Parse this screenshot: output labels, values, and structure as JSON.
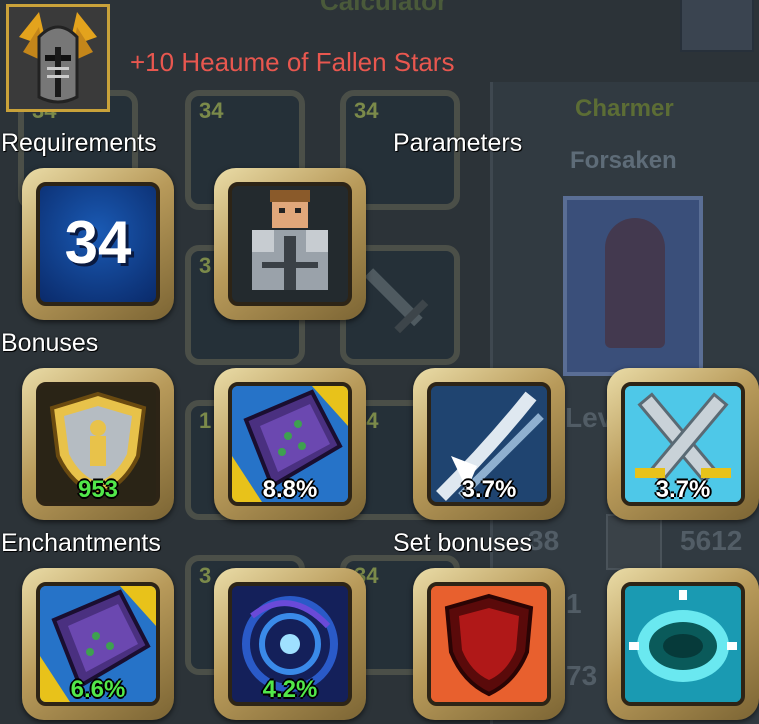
{
  "background": {
    "window_title": "Calculator",
    "grid_levels": [
      "34",
      "34",
      "34",
      "3",
      "1",
      "34",
      "3",
      "34"
    ],
    "class_name": "Charmer",
    "class_sub": "Forsaken",
    "level_label": "Lev",
    "stats": [
      "38",
      "5612",
      "1",
      "73"
    ]
  },
  "item": {
    "name": "+10 Heaume of Fallen Stars",
    "name_color": "#e8574f",
    "icon": "golden-winged-helmet-icon"
  },
  "sections": {
    "requirements": "Requirements",
    "parameters": "Parameters",
    "bonuses": "Bonuses",
    "enchantments": "Enchantments",
    "set_bonuses": "Set bonuses"
  },
  "requirements": {
    "level": "34",
    "class_icon": "armored-knight-icon"
  },
  "bonuses": [
    {
      "icon": "defense-shield-icon",
      "value": "953",
      "value_color": "green"
    },
    {
      "icon": "magic-tome-icon",
      "value": "8.8%",
      "value_color": "white"
    },
    {
      "icon": "critical-slash-icon",
      "value": "3.7%",
      "value_color": "white"
    },
    {
      "icon": "crossed-swords-icon",
      "value": "3.7%",
      "value_color": "white"
    }
  ],
  "enchantments": [
    {
      "icon": "magic-tome-icon",
      "value": "6.6%",
      "value_color": "green"
    },
    {
      "icon": "arcane-vortex-icon",
      "value": "4.2%",
      "value_color": "green"
    }
  ],
  "set_bonuses": [
    {
      "icon": "red-shield-icon"
    },
    {
      "icon": "cyan-portal-icon"
    }
  ]
}
